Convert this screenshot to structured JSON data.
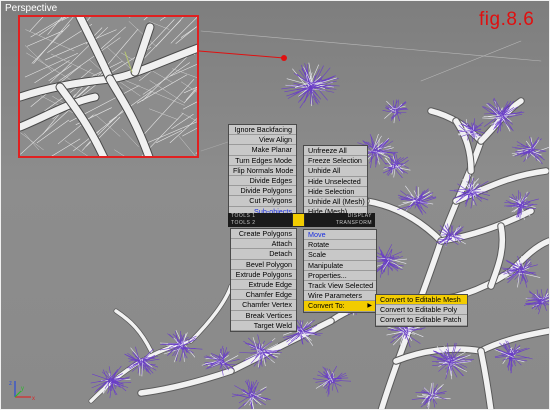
{
  "viewport": {
    "label": "Perspective",
    "figure_label": "fig.8.6"
  },
  "axis": {
    "x": "x",
    "y": "y",
    "z": "z"
  },
  "quad_menu": {
    "tools1_header": "TOOLS 1",
    "display_header": "DISPLAY",
    "tools2_header": "TOOLS 2",
    "transform_header": "TRANSFORM",
    "top_left_items": [
      "Ignore Backfacing",
      "View Align",
      "Make Planar",
      "Turn Edges Mode",
      "Flip Normals Mode",
      "Divide Edges",
      "Divide Polygons",
      "Cut Polygons",
      "Sub-objects"
    ],
    "top_right_items": [
      "Unfreeze All",
      "Freeze Selection",
      "Unhide All",
      "Hide Unselected",
      "Hide Selection",
      "Unhide All (Mesh)",
      "Hide (Mesh)"
    ],
    "bottom_left_items": [
      "Create Polygons",
      "Attach",
      "Detach",
      "Bevel Polygon",
      "Extrude Polygons",
      "Extrude Edge",
      "Chamfer Edge",
      "Chamfer Vertex",
      "Break Vertices",
      "Target Weld"
    ],
    "bottom_right_items": [
      "Move",
      "Rotate",
      "Scale",
      "Manipulate",
      "Properties...",
      "Track View Selected",
      "Wire Parameters",
      "Convert To:"
    ],
    "convert_submenu": [
      "Convert to Editable Mesh",
      "Convert to Editable Poly",
      "Convert to Editable Patch"
    ]
  },
  "colors": {
    "highlight": "#f2cc00",
    "menu_bg": "#c8c8c8",
    "foliage": "#6a3ec8",
    "branch": "#f2f2f2",
    "callout": "#e01010"
  }
}
